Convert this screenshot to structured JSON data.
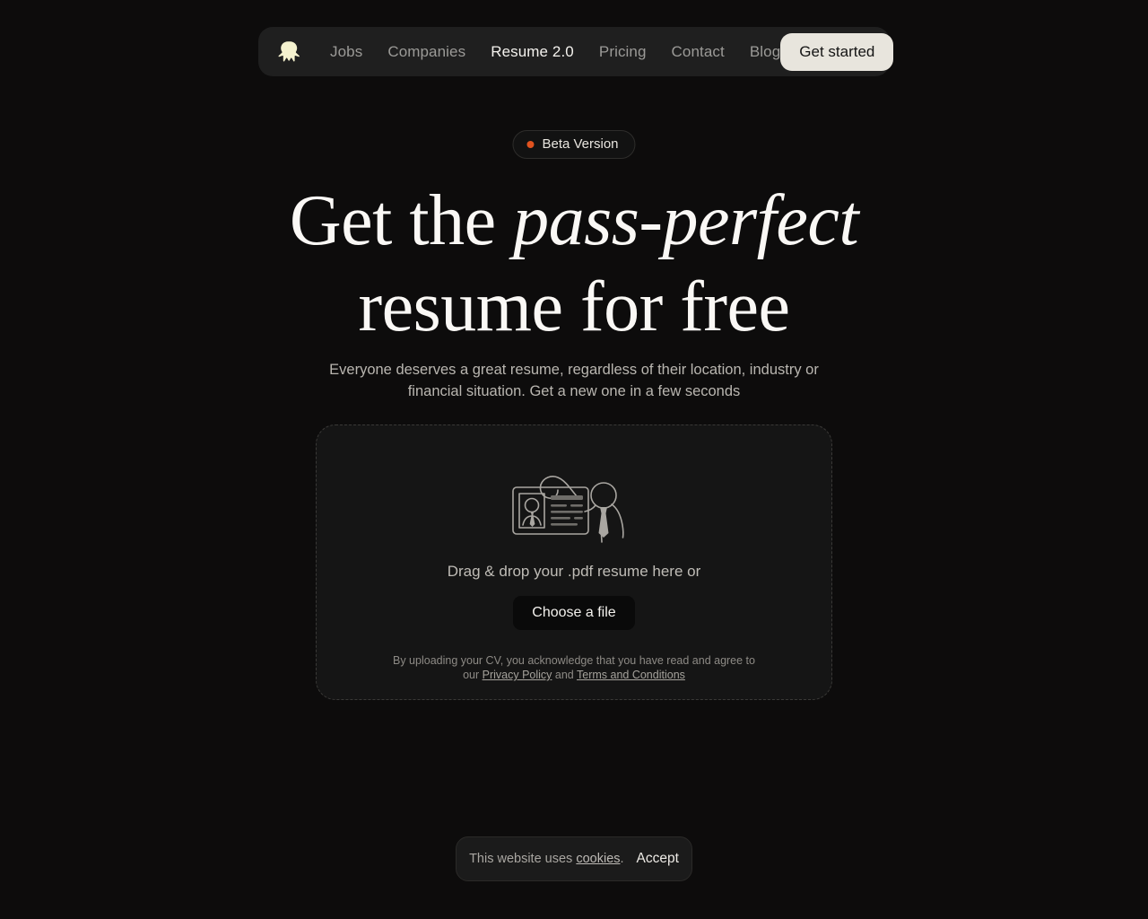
{
  "navbar": {
    "logo_icon": "octopus-logo-icon",
    "links": [
      {
        "label": "Jobs",
        "active": false
      },
      {
        "label": "Companies",
        "active": false
      },
      {
        "label": "Resume 2.0",
        "active": true
      },
      {
        "label": "Pricing",
        "active": false
      },
      {
        "label": "Contact",
        "active": false
      },
      {
        "label": "Blog",
        "active": false
      }
    ],
    "cta_label": "Get started"
  },
  "hero": {
    "badge": {
      "label": "Beta Version",
      "dot_color": "#e0521f"
    },
    "headline_part1": "Get the ",
    "headline_emphasis": "pass-perfect",
    "headline_part2": "resume for free",
    "subtitle": "Everyone deserves a great resume, regardless of their location, industry or financial situation. Get a new one in a few seconds"
  },
  "upload": {
    "illustration_icon": "resume-id-card-person-icon",
    "dragdrop_text": "Drag & drop your .pdf resume here or",
    "choose_file_label": "Choose a file",
    "legal_prefix": "By uploading your CV, you acknowledge that you have read and agree to our ",
    "legal_privacy_link": "Privacy Policy",
    "legal_conjunction": " and ",
    "legal_terms_link": "Terms and Conditions"
  },
  "cookie_banner": {
    "text_prefix": "This website uses ",
    "link_label": "cookies",
    "text_suffix": ".",
    "accept_label": "Accept"
  },
  "colors": {
    "page_background": "#0d0c0c",
    "navbar_background": "#1f1f1f",
    "accent_cream": "#e8e5dd",
    "beta_orange": "#e0521f",
    "card_background": "#151515"
  }
}
